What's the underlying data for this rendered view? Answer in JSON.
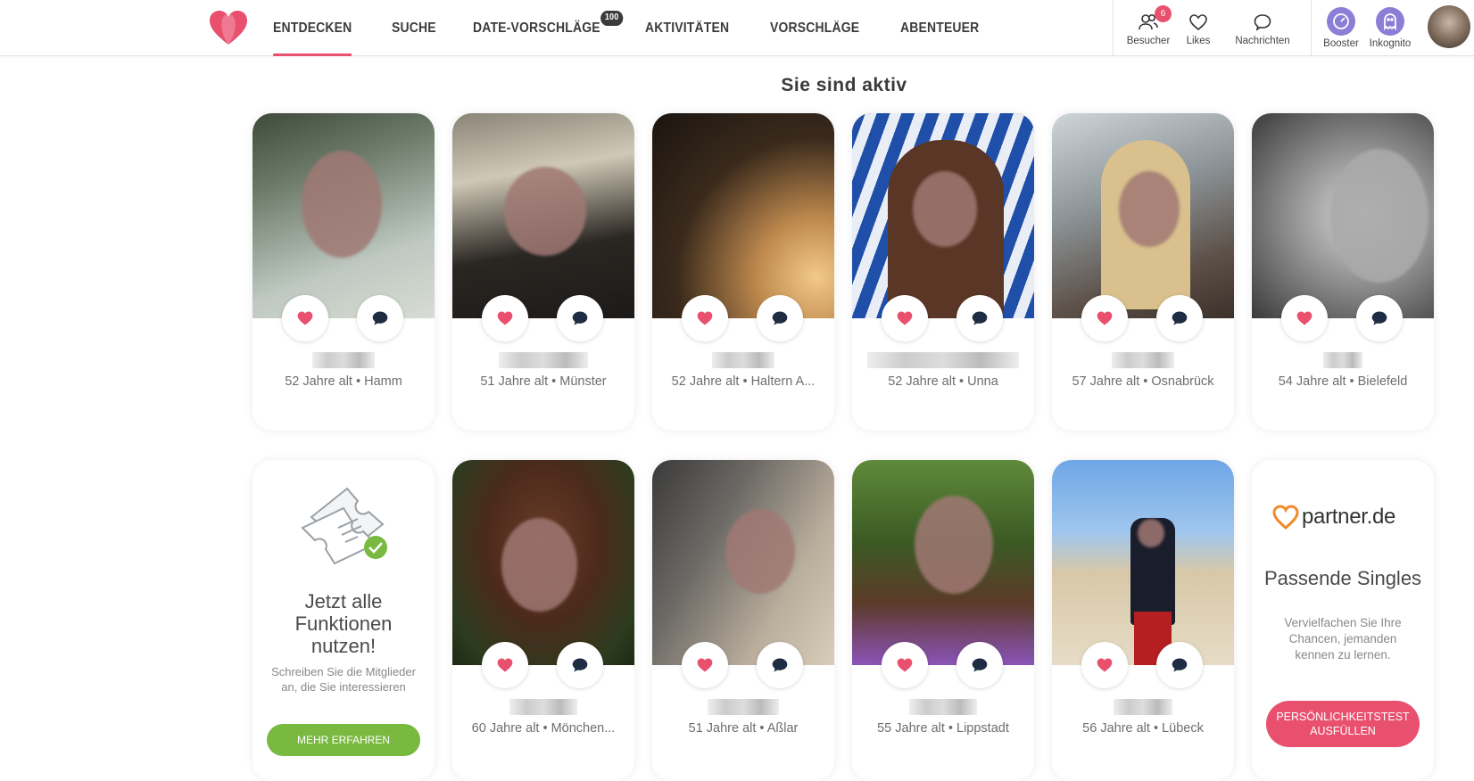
{
  "nav": {
    "items": [
      {
        "label": "ENTDECKEN",
        "active": true
      },
      {
        "label": "SUCHE"
      },
      {
        "label": "DATE-VORSCHLÄGE",
        "badge": "100"
      },
      {
        "label": "AKTIVITÄTEN"
      },
      {
        "label": "VORSCHLÄGE"
      },
      {
        "label": "ABENTEUER"
      }
    ]
  },
  "right_nav": {
    "besucher": {
      "label": "Besucher",
      "badge": "6"
    },
    "likes": {
      "label": "Likes"
    },
    "nachrichten": {
      "label": "Nachrichten"
    },
    "booster": {
      "label": "Booster"
    },
    "inkognito": {
      "label": "Inkognito"
    }
  },
  "section_title": "Sie sind aktiv",
  "cards_row1": [
    {
      "info": "52 Jahre alt • Hamm"
    },
    {
      "info": "51 Jahre alt • Münster"
    },
    {
      "info": "52 Jahre alt • Haltern A..."
    },
    {
      "info": "52 Jahre alt • Unna"
    },
    {
      "info": "57 Jahre alt • Osnabrück"
    },
    {
      "info": "54 Jahre alt • Bielefeld"
    }
  ],
  "cards_row2": [
    {
      "info": "60 Jahre alt • Mönchen..."
    },
    {
      "info": "51 Jahre alt • Aßlar"
    },
    {
      "info": "55 Jahre alt • Lippstadt"
    },
    {
      "info": "56 Jahre alt • Lübeck"
    }
  ],
  "promo": {
    "title_line1": "Jetzt alle",
    "title_line2": "Funktionen",
    "title_line3": "nutzen!",
    "text": "Schreiben Sie die Mitglieder an, die Sie interessieren",
    "button": "MEHR ERFAHREN"
  },
  "partner_ad": {
    "brand": "partner.de",
    "title": "Passende Singles",
    "text": "Vervielfachen Sie Ihre Chancen, jemanden kennen zu lernen.",
    "button_line1": "PERSÖNLICHKEITSTEST",
    "button_line2": "AUSFÜLLEN"
  },
  "colors": {
    "accent": "#e8506e",
    "green": "#7ab93f",
    "booster": "#8b7ed6",
    "msg": "#1f2d44"
  }
}
